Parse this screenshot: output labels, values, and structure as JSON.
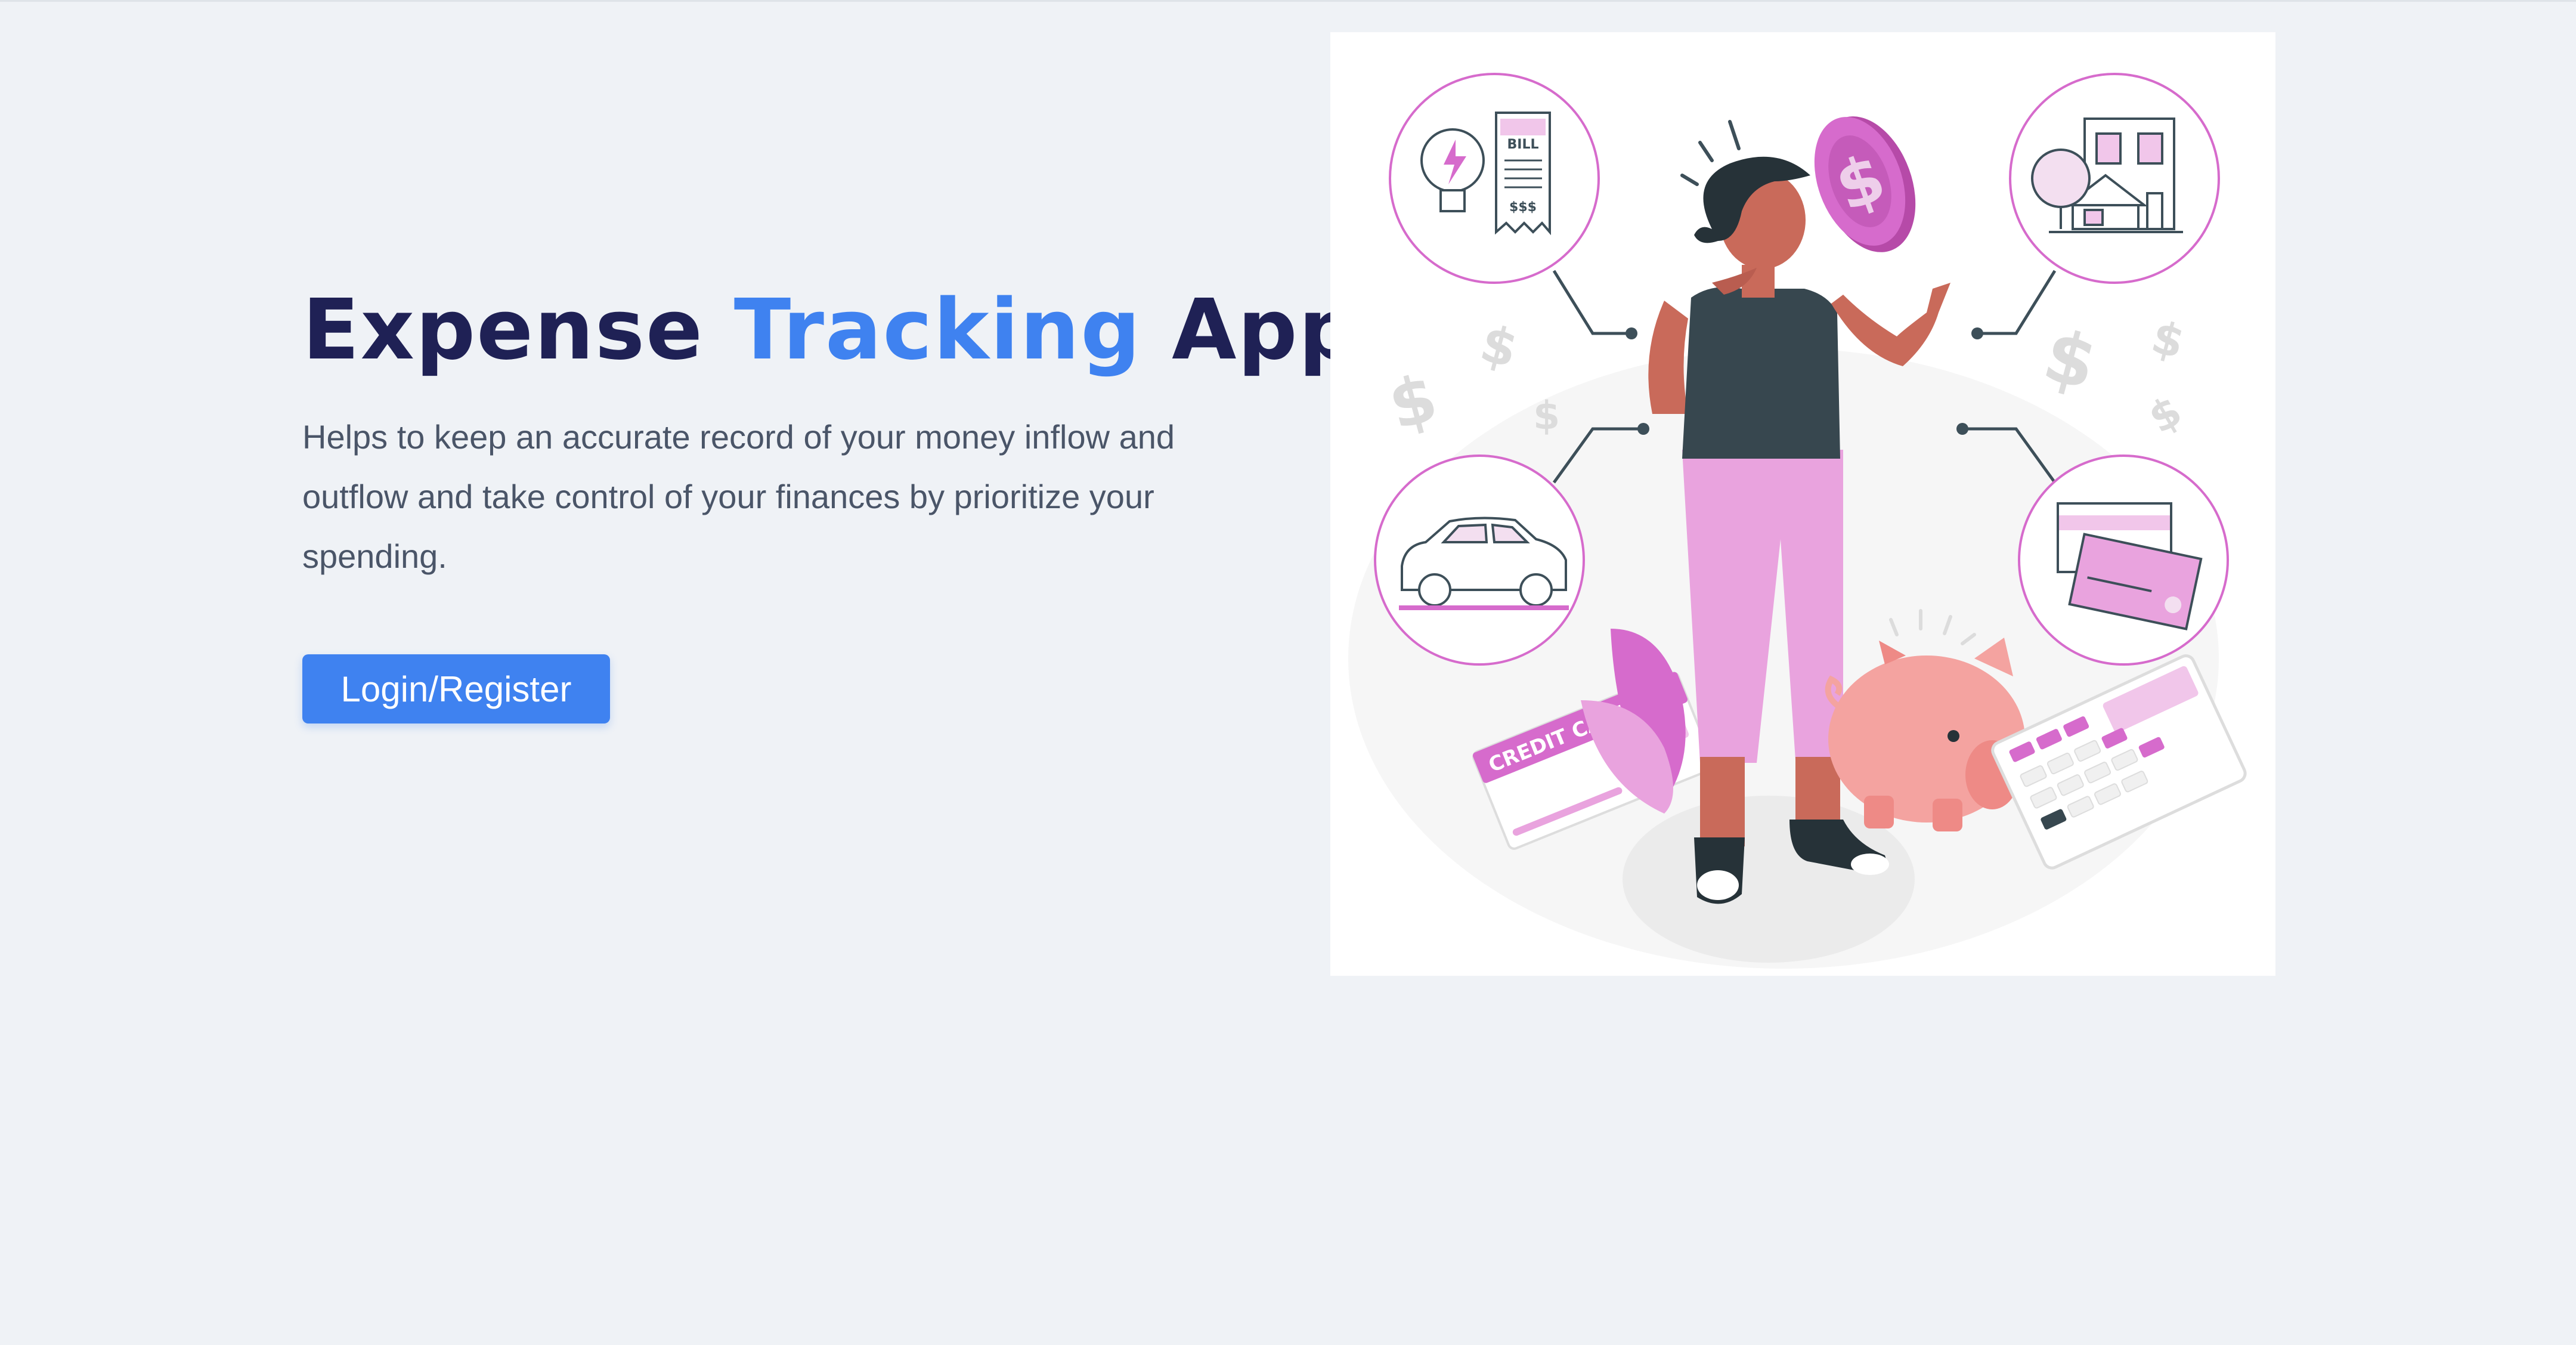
{
  "hero": {
    "title_part1": "Expense ",
    "title_accent": "Tracking",
    "title_part2": " App",
    "description": "Helps to keep an accurate record of your money inflow and outflow and take control of your finances by prioritize your spending.",
    "cta_label": "Login/Register"
  },
  "illustration": {
    "bill_label": "BILL",
    "bill_amount": "$$$",
    "card_label": "CREDIT CARD"
  },
  "colors": {
    "background": "#eff2f6",
    "title": "#1f2155",
    "accent": "#3f82f0",
    "text": "#4a5568",
    "pink": "#d66bcc"
  }
}
